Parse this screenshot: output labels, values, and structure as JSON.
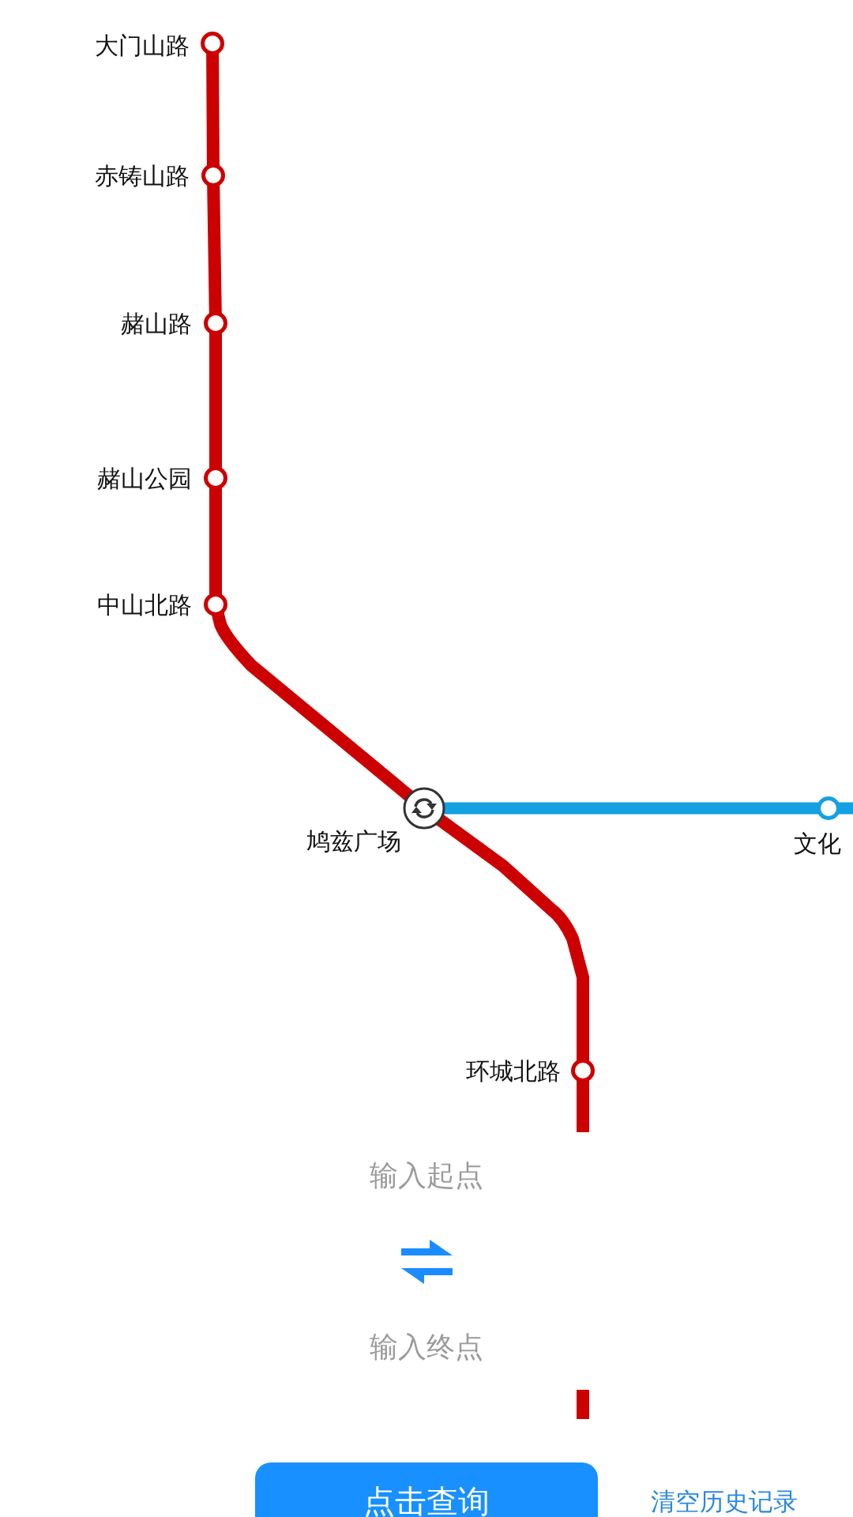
{
  "map": {
    "lines": [
      {
        "color": "#cc0000",
        "stations": [
          {
            "name": "大门山路",
            "kind": "station"
          },
          {
            "name": "赤铸山路",
            "kind": "station"
          },
          {
            "name": "赭山路",
            "kind": "station"
          },
          {
            "name": "赭山公园",
            "kind": "station"
          },
          {
            "name": "中山北路",
            "kind": "station"
          },
          {
            "name": "鸠兹广场",
            "kind": "interchange"
          },
          {
            "name": "环城北路",
            "kind": "station"
          }
        ]
      },
      {
        "color": "#14a0e2",
        "stations": [
          {
            "name": "文化",
            "kind": "station"
          }
        ]
      }
    ]
  },
  "route_form": {
    "start": {
      "placeholder": "输入起点"
    },
    "end": {
      "placeholder": "输入终点"
    }
  },
  "query_button": {
    "label": "点击查询"
  },
  "clear_history_link": {
    "label": "清空历史记录"
  }
}
